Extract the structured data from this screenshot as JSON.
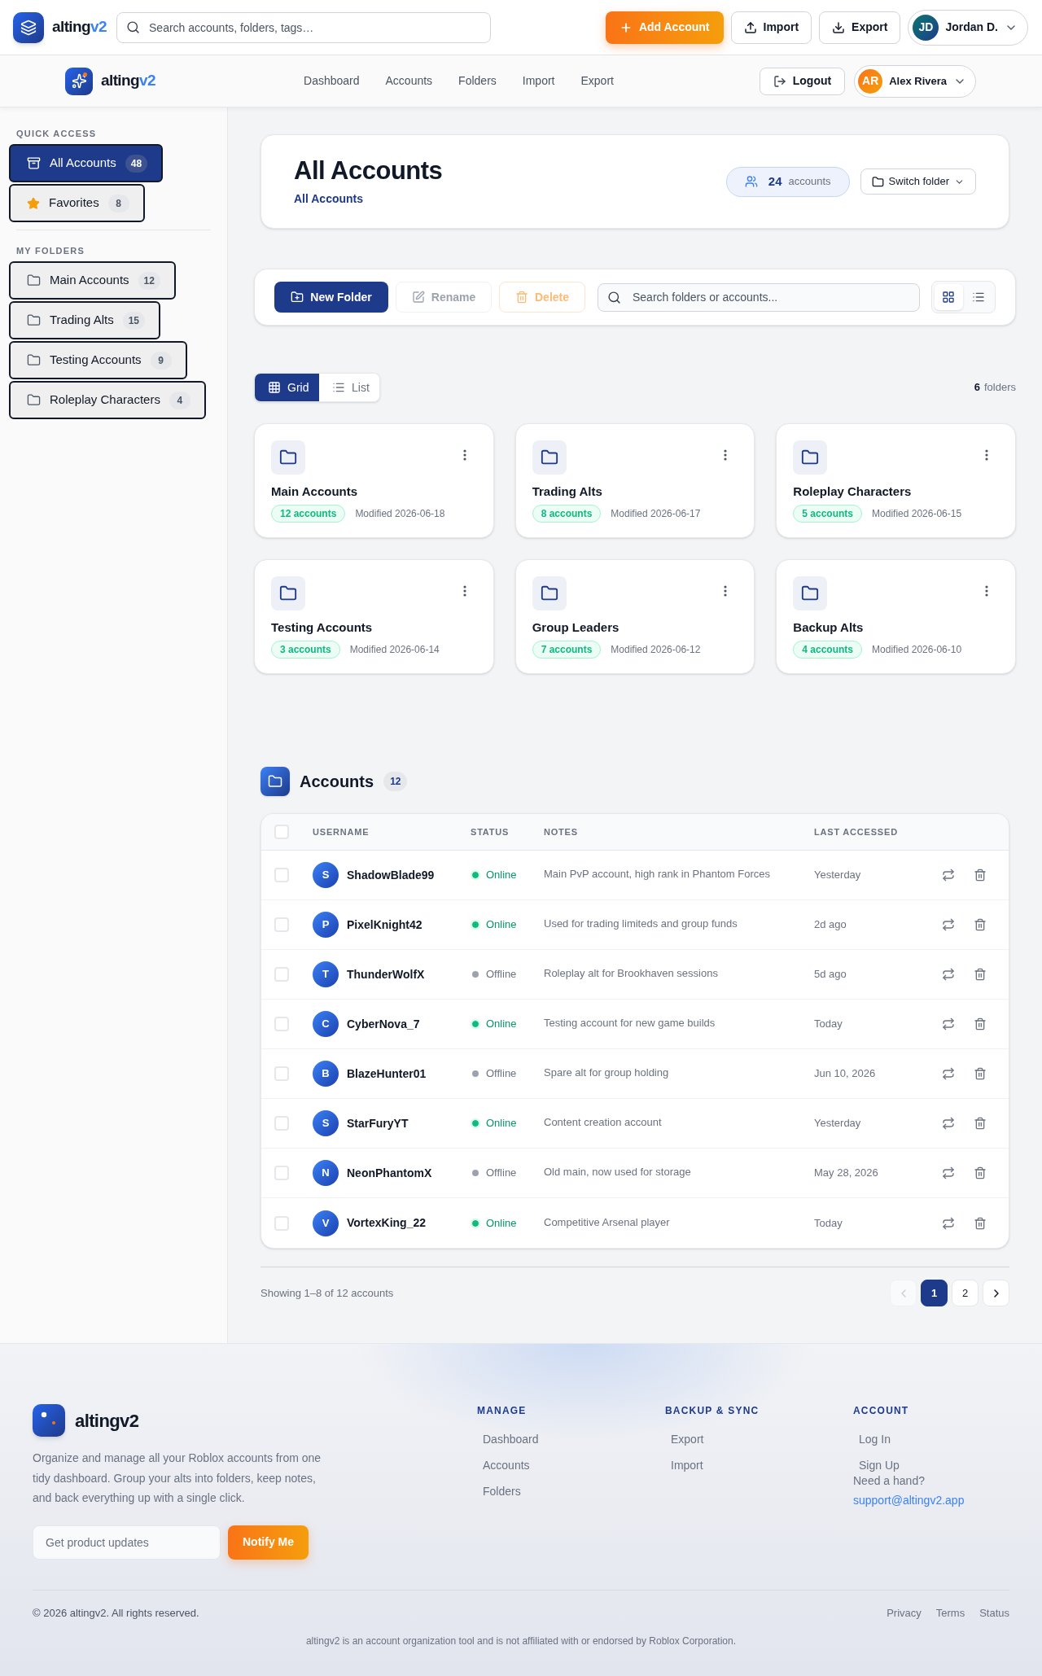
{
  "top_bar": {
    "logo": {
      "name": "alting",
      "accent": "v2"
    },
    "search": {
      "placeholder": "Search accounts, folders, tags…"
    },
    "buttons": [
      {
        "label": "Add Account",
        "kind": "add"
      },
      {
        "label": "Import",
        "kind": "import"
      },
      {
        "label": "Export",
        "kind": "export"
      }
    ],
    "user": {
      "initials": "JD",
      "name": "Jordan D."
    }
  },
  "nav_bar": {
    "logo": {
      "name": "alting",
      "accent": "v2"
    },
    "links": [
      "Dashboard",
      "Accounts",
      "Folders",
      "Import",
      "Export"
    ],
    "logout": "Logout",
    "user": {
      "initials": "AR",
      "name": "Alex Rivera"
    }
  },
  "sidebar": {
    "sections": [
      {
        "heading": "QUICK ACCESS",
        "items": [
          {
            "label": "All Accounts",
            "count": "48",
            "kind": "archive",
            "selected": true
          },
          {
            "label": "Favorites",
            "count": "8",
            "kind": "star",
            "selected": false
          }
        ]
      },
      {
        "heading": "MY FOLDERS",
        "items": [
          {
            "label": "Main Accounts",
            "count": "12",
            "kind": "folder",
            "selected": false
          },
          {
            "label": "Trading Alts",
            "count": "15",
            "kind": "folder",
            "selected": false
          },
          {
            "label": "Testing Accounts",
            "count": "9",
            "kind": "folder",
            "selected": false
          },
          {
            "label": "Roleplay Characters",
            "count": "4",
            "kind": "folder",
            "selected": false
          }
        ]
      }
    ]
  },
  "header_card": {
    "title": "All Accounts",
    "breadcrumb": "All Accounts",
    "count": "24",
    "count_label": "accounts",
    "switch_button": "Switch folder"
  },
  "toolbar": {
    "buttons": [
      {
        "label": "New Folder",
        "kind": "new",
        "disabled": false
      },
      {
        "label": "Rename",
        "kind": "rename",
        "disabled": true
      },
      {
        "label": "Delete",
        "kind": "delete",
        "disabled": true
      }
    ],
    "search": {
      "placeholder": "Search folders or accounts..."
    },
    "view_toggle": [
      {
        "kind": "grid",
        "selected": true
      },
      {
        "kind": "list",
        "selected": false
      }
    ]
  },
  "view_switch": {
    "options": [
      {
        "label": "Grid",
        "kind": "grid",
        "selected": true
      },
      {
        "label": "List",
        "kind": "list",
        "selected": false
      }
    ],
    "folder_count": "6",
    "folder_count_label": "folders"
  },
  "folders": [
    {
      "name": "Main Accounts",
      "badge": "12 accounts",
      "modified": "Modified 2026-06-18"
    },
    {
      "name": "Trading Alts",
      "badge": "8 accounts",
      "modified": "Modified 2026-06-17"
    },
    {
      "name": "Roleplay Characters",
      "badge": "5 accounts",
      "modified": "Modified 2026-06-15"
    },
    {
      "name": "Testing Accounts",
      "badge": "3 accounts",
      "modified": "Modified 2026-06-14"
    },
    {
      "name": "Group Leaders",
      "badge": "7 accounts",
      "modified": "Modified 2026-06-12"
    },
    {
      "name": "Backup Alts",
      "badge": "4 accounts",
      "modified": "Modified 2026-06-10"
    }
  ],
  "accounts": {
    "title": "Accounts",
    "count": "12",
    "select_all": {
      "checked": false
    },
    "columns": [
      "USERNAME",
      "STATUS",
      "NOTES",
      "LAST ACCESSED"
    ],
    "rows": [
      {
        "initial": "S",
        "username": "ShadowBlade99",
        "status": "Online",
        "online": true,
        "notes": "Main PvP account, high rank in Phantom Forces",
        "last_accessed": "Yesterday",
        "checked": false
      },
      {
        "initial": "P",
        "username": "PixelKnight42",
        "status": "Online",
        "online": true,
        "notes": "Used for trading limiteds and group funds",
        "last_accessed": "2d ago",
        "checked": false
      },
      {
        "initial": "T",
        "username": "ThunderWolfX",
        "status": "Offline",
        "online": false,
        "notes": "Roleplay alt for Brookhaven sessions",
        "last_accessed": "5d ago",
        "checked": false
      },
      {
        "initial": "C",
        "username": "CyberNova_7",
        "status": "Online",
        "online": true,
        "notes": "Testing account for new game builds",
        "last_accessed": "Today",
        "checked": false
      },
      {
        "initial": "B",
        "username": "BlazeHunter01",
        "status": "Offline",
        "online": false,
        "notes": "Spare alt for group holding",
        "last_accessed": "Jun 10, 2026",
        "checked": false
      },
      {
        "initial": "S",
        "username": "StarFuryYT",
        "status": "Online",
        "online": true,
        "notes": "Content creation account",
        "last_accessed": "Yesterday",
        "checked": false
      },
      {
        "initial": "N",
        "username": "NeonPhantomX",
        "status": "Offline",
        "online": false,
        "notes": "Old main, now used for storage",
        "last_accessed": "May 28, 2026",
        "checked": false
      },
      {
        "initial": "V",
        "username": "VortexKing_22",
        "status": "Online",
        "online": true,
        "notes": "Competitive Arsenal player",
        "last_accessed": "Today",
        "checked": false
      }
    ]
  },
  "pagination": {
    "summary": "Showing 1–8 of 12 accounts",
    "previous": {
      "disabled": true
    },
    "pages": [
      {
        "label": "1",
        "selected": true
      },
      {
        "label": "2",
        "selected": false
      }
    ],
    "next": {
      "disabled": false
    }
  },
  "footer": {
    "brand": "altingv2",
    "description": "Organize and manage all your Roblox accounts from one tidy dashboard. Group your alts into folders, keep notes, and back everything up with a single click.",
    "newsletter": {
      "placeholder": "Get product updates",
      "button": "Notify Me"
    },
    "columns": [
      {
        "heading": "MANAGE",
        "links": [
          "Dashboard",
          "Accounts",
          "Folders"
        ]
      },
      {
        "heading": "BACKUP & SYNC",
        "links": [
          "Export",
          "Import"
        ]
      },
      {
        "heading": "ACCOUNT",
        "links": [
          "Log In",
          "Sign Up"
        ],
        "help": {
          "text": "Need a hand?",
          "email": "support@altingv2.app"
        }
      }
    ],
    "copyright": "© 2026 altingv2. All rights reserved.",
    "legal_links": [
      "Privacy",
      "Terms",
      "Status"
    ],
    "disclaimer": "altingv2 is an account organization tool and is not affiliated with or endorsed by Roblox Corporation."
  }
}
